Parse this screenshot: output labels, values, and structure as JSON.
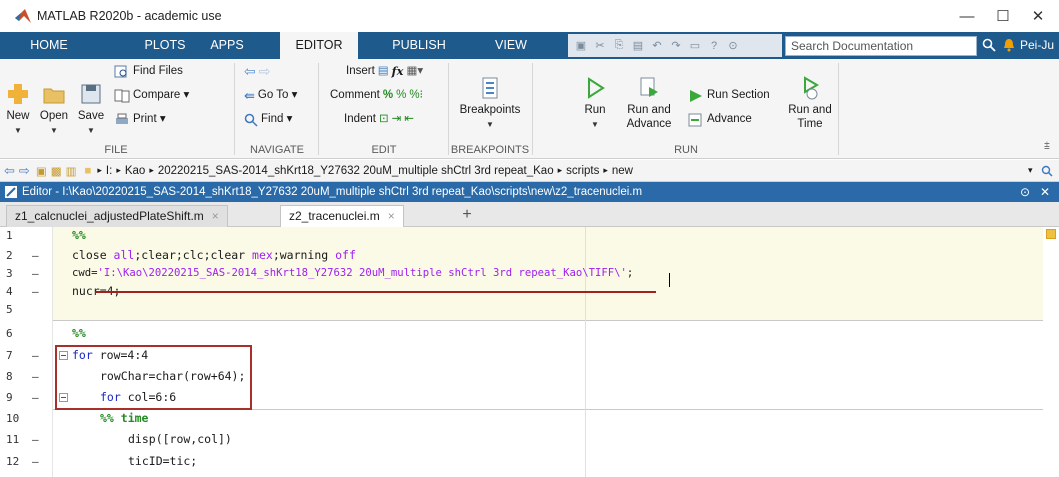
{
  "window": {
    "title": "MATLAB R2020b - academic use",
    "minimize_glyph": "—",
    "maximize_glyph": "☐",
    "close_glyph": "✕"
  },
  "ribbon": {
    "tabs": [
      "HOME",
      "PLOTS",
      "APPS",
      "EDITOR",
      "PUBLISH",
      "VIEW"
    ],
    "active_tab": "EDITOR",
    "search_placeholder": "Search Documentation",
    "user": "Pei-Ju ▾",
    "file_group": {
      "label": "FILE",
      "new": "New",
      "open": "Open",
      "save": "Save",
      "find_files": "Find Files",
      "compare": "Compare ▾",
      "print": "Print ▾"
    },
    "navigate_group": {
      "label": "NAVIGATE",
      "go_to": "Go To ▾",
      "find": "Find ▾"
    },
    "edit_group": {
      "label": "EDIT",
      "insert": "Insert",
      "comment": "Comment",
      "indent": "Indent"
    },
    "breakpoints_group": {
      "label": "BREAKPOINTS",
      "breakpoints": "Breakpoints"
    },
    "run_group": {
      "label": "RUN",
      "run": "Run",
      "run_and_advance_1": "Run and",
      "run_and_advance_2": "Advance",
      "run_section": "Run Section",
      "advance": "Advance",
      "run_and_time_1": "Run and",
      "run_and_time_2": "Time"
    }
  },
  "address_bar": {
    "path": [
      "I:",
      "Kao",
      "20220215_SAS-2014_shKrt18_Y27632 20uM_multiple shCtrl 3rd repeat_Kao",
      "scripts",
      "new"
    ]
  },
  "editor": {
    "title": "Editor - I:\\Kao\\20220215_SAS-2014_shKrt18_Y27632 20uM_multiple shCtrl 3rd repeat_Kao\\scripts\\new\\z2_tracenuclei.m",
    "file_tabs": [
      "z1_calcnuclei_adjustedPlateShift.m",
      "z2_tracenuclei.m"
    ],
    "active_file": "z2_tracenuclei.m",
    "close_glyph": "×",
    "new_tab_glyph": "+",
    "line_numbers": [
      "1",
      "2",
      "3",
      "4",
      "5",
      "6",
      "7",
      "8",
      "9",
      "10",
      "11",
      "12"
    ],
    "exec_dash": "–",
    "lines": {
      "l1_comment": "%%",
      "l2_a": "close ",
      "l2_b": "all",
      "l2_c": ";clear;clc;clear ",
      "l2_d": "mex",
      "l2_e": ";warning ",
      "l2_f": "off",
      "l3_a": "cwd=",
      "l3_str": "'I:\\Kao\\20220215_SAS-2014_shKrt18_Y27632 20uM_multiple shCtrl 3rd repeat_Kao\\TIFF\\'",
      "l3_end": ";",
      "l4": "nucr=4;",
      "l6_comment": "%%",
      "l7_kw": "for",
      "l7_rest": " row=4:4",
      "l8": "rowChar=char(row+64);",
      "l9_kw": "for",
      "l9_rest": " col=6:6",
      "l10_comment": "%% time",
      "l11": "disp([row,col])",
      "l12": "ticID=tic;"
    }
  },
  "colors": {
    "tab_bar": "#1f5a8c",
    "editor_title": "#2a6aa8",
    "keyword": "#1b26c9",
    "comment": "#228b22",
    "string": "#a020f0",
    "annotation": "#a9302a"
  }
}
